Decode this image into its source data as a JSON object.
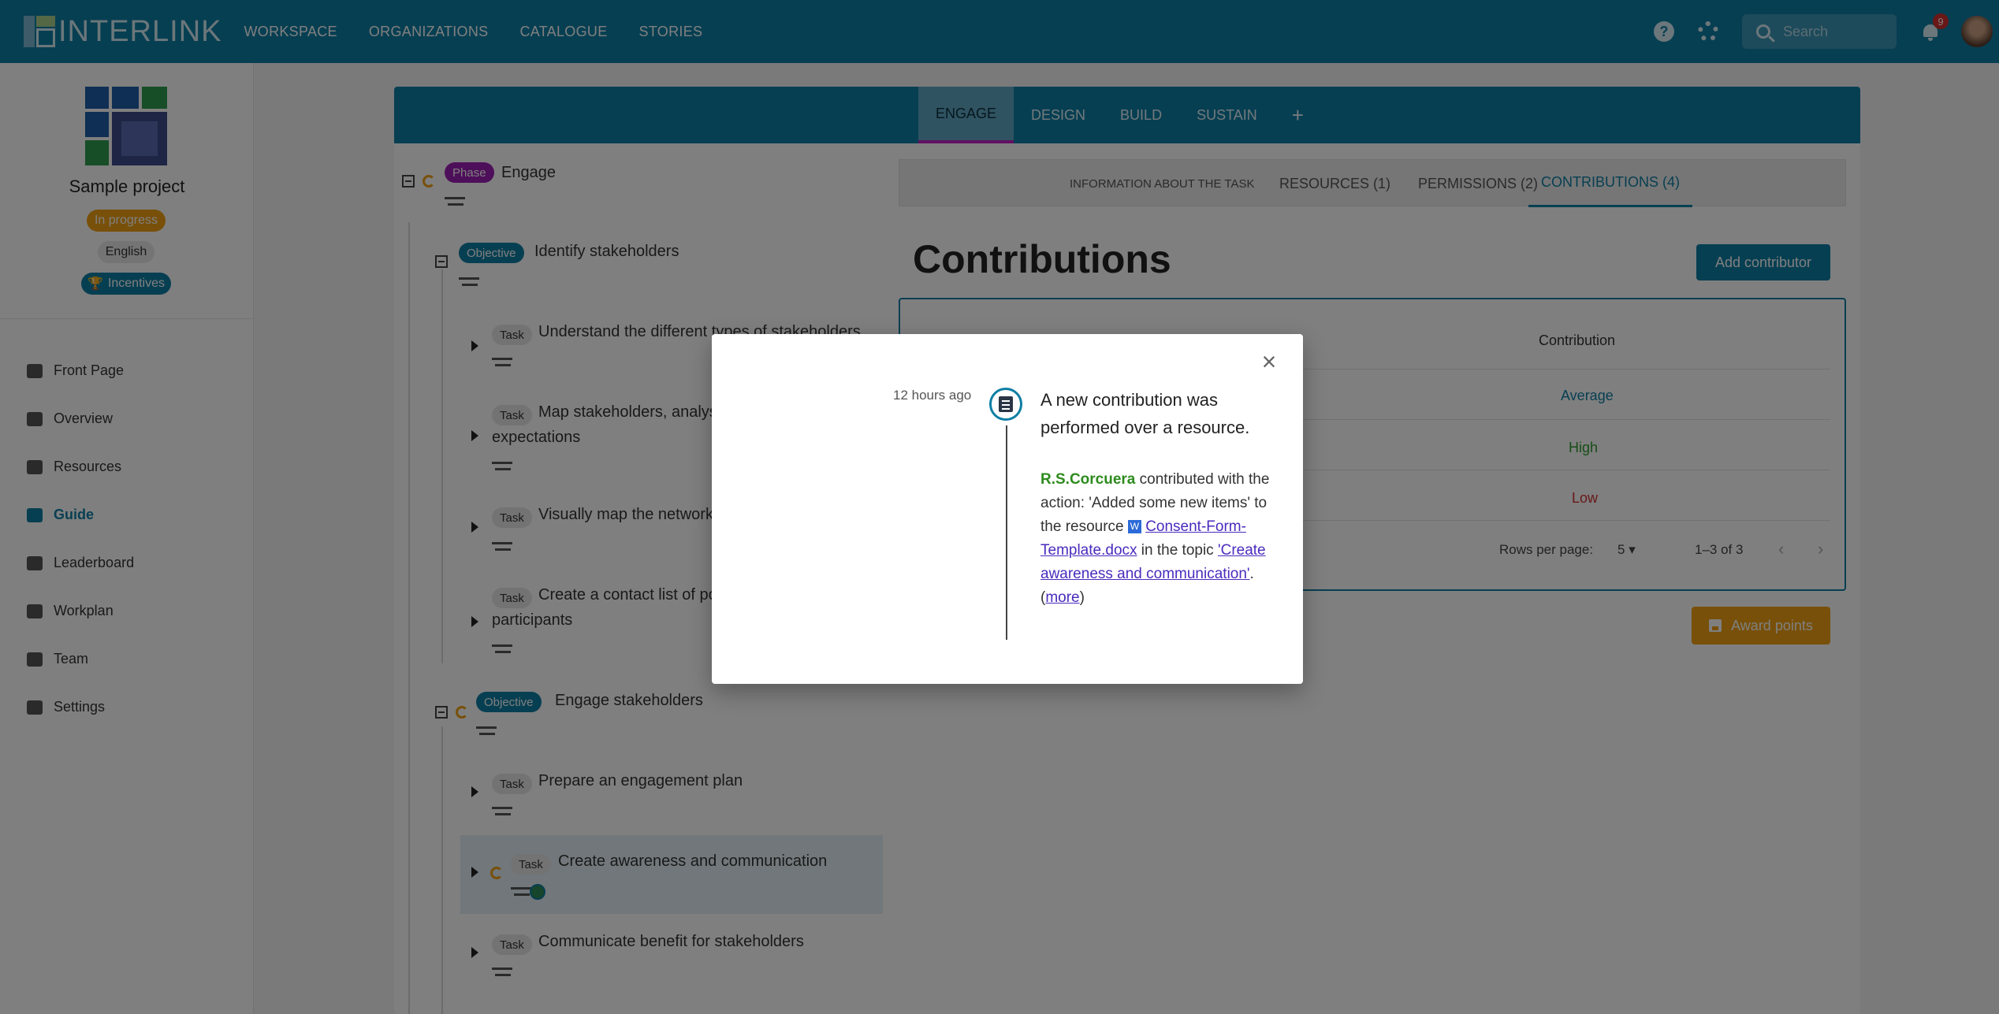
{
  "app": {
    "logo_text": "INTERLINK",
    "nav": [
      "WORKSPACE",
      "ORGANIZATIONS",
      "CATALOGUE",
      "STORIES"
    ],
    "search_placeholder": "Search",
    "notification_count": "9"
  },
  "project": {
    "title": "Sample project",
    "status": "In progress",
    "language": "English",
    "incentives": "Incentives"
  },
  "sidebar": {
    "items": [
      {
        "label": "Front Page",
        "icon": "front-page-icon"
      },
      {
        "label": "Overview",
        "icon": "overview-icon"
      },
      {
        "label": "Resources",
        "icon": "resources-icon"
      },
      {
        "label": "Guide",
        "icon": "guide-icon"
      },
      {
        "label": "Leaderboard",
        "icon": "leaderboard-icon"
      },
      {
        "label": "Workplan",
        "icon": "workplan-icon"
      },
      {
        "label": "Team",
        "icon": "team-icon"
      },
      {
        "label": "Settings",
        "icon": "settings-icon"
      }
    ]
  },
  "phases": {
    "tabs": [
      "ENGAGE",
      "DESIGN",
      "BUILD",
      "SUSTAIN",
      "+"
    ]
  },
  "tree": {
    "phase": {
      "tag": "Phase",
      "name": "Engage"
    },
    "objectives": [
      {
        "tag": "Objective",
        "name": "Identify stakeholders"
      },
      {
        "tag": "Objective",
        "name": "Engage stakeholders"
      }
    ],
    "tasks": [
      {
        "tag": "Task",
        "line1": "Understand the different types of stakeholders",
        "line2": ""
      },
      {
        "tag": "Task",
        "line1": "Map stakeholders, analys",
        "line2": "expectations"
      },
      {
        "tag": "Task",
        "line1": "Visually map the network",
        "line2": ""
      },
      {
        "tag": "Task",
        "line1": "Create a contact list of po",
        "line2": "participants"
      },
      {
        "tag": "Task",
        "line1": "Prepare an engagement plan",
        "line2": ""
      },
      {
        "tag": "Task",
        "line1": "Create awareness and communication",
        "line2": ""
      },
      {
        "tag": "Task",
        "line1": "Communicate benefit for stakeholders",
        "line2": ""
      }
    ]
  },
  "panel": {
    "subtabs": [
      "INFORMATION ABOUT THE TASK",
      "RESOURCES (1)",
      "PERMISSIONS (2)",
      "CONTRIBUTIONS (4)"
    ],
    "heading": "Contributions",
    "add_button": "Add contributor",
    "table": {
      "col_contribution": "Contribution",
      "rows": [
        "Average",
        "High",
        "Low"
      ],
      "rows_per_page_label": "Rows per page:",
      "rows_per_page": "5",
      "range": "1–3 of 3"
    },
    "award_button": "Award points"
  },
  "modal": {
    "time": "12 hours ago",
    "title": "A new contribution was performed over a resource.",
    "user": "R.S.Corcuera",
    "text1": " contributed with the action: 'Added some new items' to the resource ",
    "file_icon": "W",
    "file": "Consent-Form-Template.docx",
    "text2": " in the topic ",
    "topic": "'Create awareness and communication'",
    "text3": ". (",
    "more": "more",
    "text4": ")",
    "close": "×"
  },
  "colors": {
    "primary": "#0e7fa4",
    "phase": "#9c1fb5",
    "warning": "#f0a012",
    "average": "#0e7fa4",
    "high": "#2e9b2e",
    "low": "#d32f2f"
  }
}
